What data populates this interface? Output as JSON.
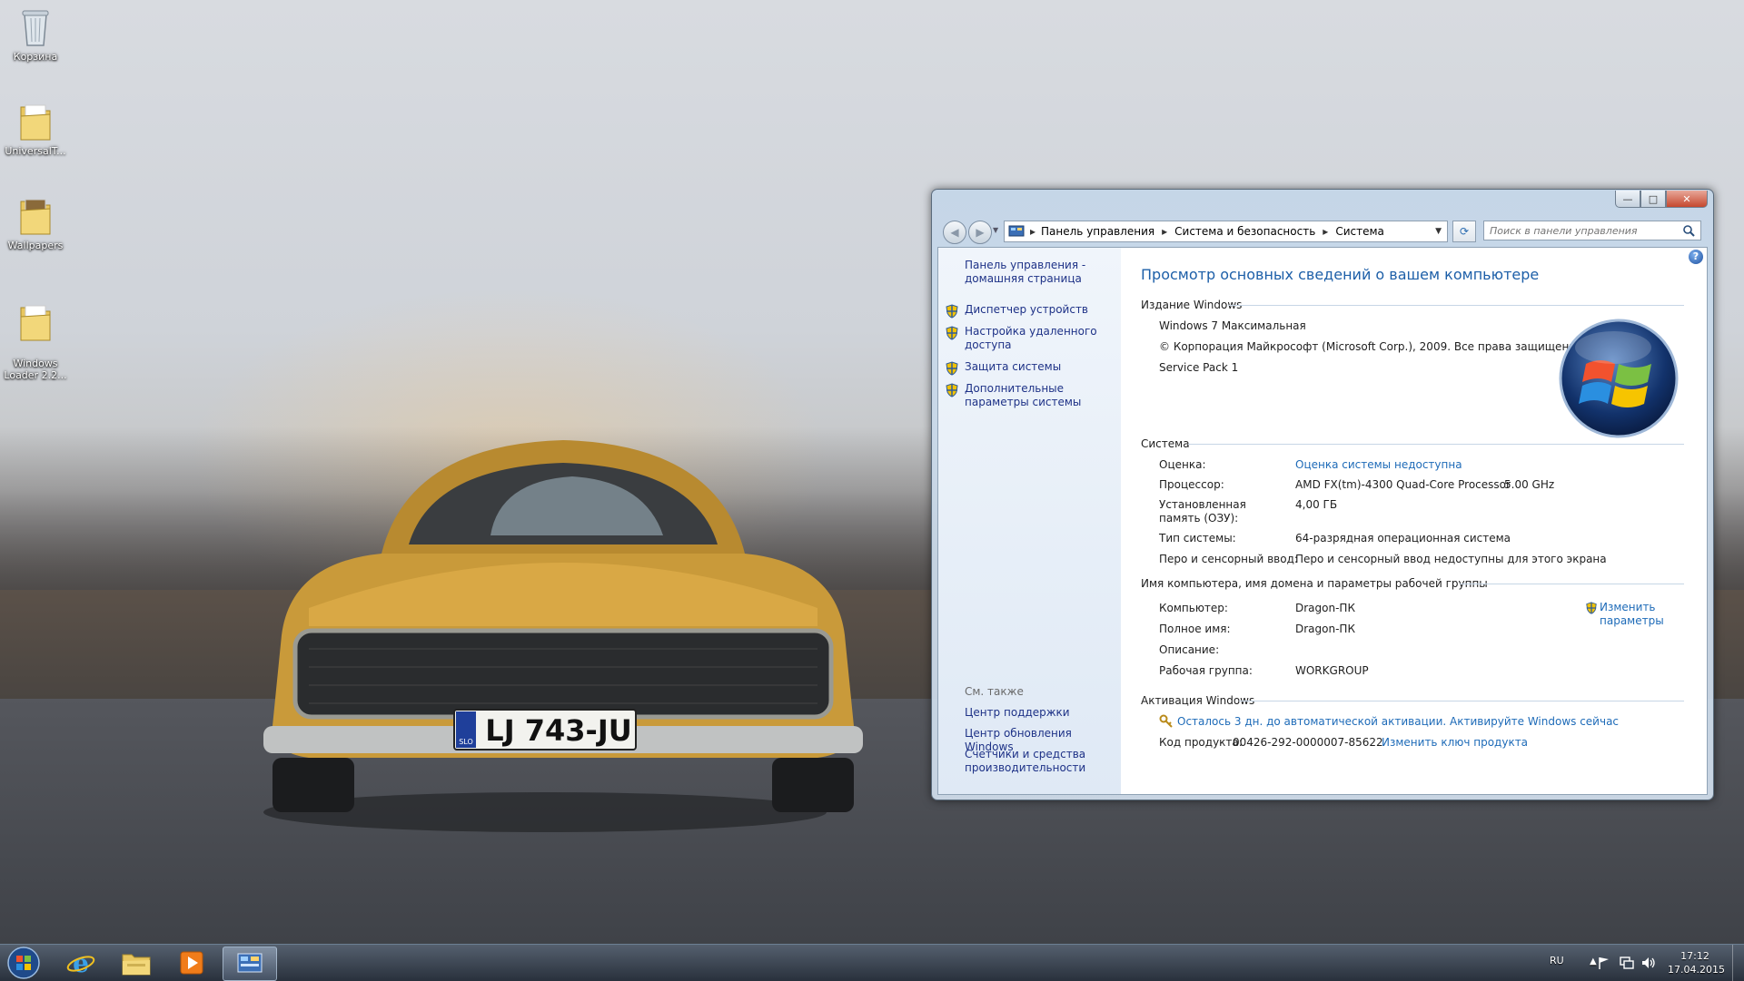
{
  "desktop": {
    "icons": [
      {
        "label": "Корзина",
        "icon": "recycle-bin-icon"
      },
      {
        "label": "UniversalT...",
        "icon": "folder-icon"
      },
      {
        "label": "Wallpapers",
        "icon": "folder-icon"
      },
      {
        "label": "Windows\nLoader 2.2...",
        "icon": "folder-icon"
      }
    ],
    "plate": "LJ 743-JU",
    "plate_country": "SLO"
  },
  "window": {
    "controls": {
      "minimize": "—",
      "maximize": "□",
      "close": "✕"
    },
    "breadcrumb": [
      "Панель управления",
      "Система и безопасность",
      "Система"
    ],
    "search_placeholder": "Поиск в панели управления",
    "left_pane": {
      "home_link": "Панель управления - домашняя страница",
      "tasks": [
        "Диспетчер устройств",
        "Настройка удаленного доступа",
        "Защита системы",
        "Дополнительные параметры системы"
      ],
      "see_also_heading": "См. также",
      "see_also": [
        "Центр поддержки",
        "Центр обновления Windows",
        "Счетчики и средства производительности"
      ]
    },
    "main": {
      "title": "Просмотр основных сведений о вашем компьютере",
      "edition": {
        "heading": "Издание Windows",
        "name": "Windows 7 Максимальная",
        "copyright": "© Корпорация Майкрософт (Microsoft Corp.), 2009. Все права защищены.",
        "service_pack": "Service Pack 1"
      },
      "system": {
        "heading": "Система",
        "rating_label": "Оценка:",
        "rating_value": "Оценка системы недоступна",
        "cpu_label": "Процессор:",
        "cpu_value": "AMD FX(tm)-4300 Quad-Core Processor",
        "cpu_speed": "5.00 GHz",
        "ram_label": "Установленная память (ОЗУ):",
        "ram_value": "4,00 ГБ",
        "type_label": "Тип системы:",
        "type_value": "64-разрядная операционная система",
        "pen_label": "Перо и сенсорный ввод:",
        "pen_value": "Перо и сенсорный ввод недоступны для этого экрана"
      },
      "computer": {
        "heading": "Имя компьютера, имя домена и параметры рабочей группы",
        "name_label": "Компьютер:",
        "name_value": "Dragon-ПК",
        "full_label": "Полное имя:",
        "full_value": "Dragon-ПК",
        "desc_label": "Описание:",
        "desc_value": "",
        "wg_label": "Рабочая группа:",
        "wg_value": "WORKGROUP",
        "change_link": "Изменить параметры"
      },
      "activation": {
        "heading": "Активация Windows",
        "notice": "Осталось 3 дн. до автоматической активации. Активируйте Windows сейчас",
        "key_label": "Код продукта:",
        "key_value": "00426-292-0000007-85622",
        "change_key": "Изменить ключ продукта"
      }
    }
  },
  "taskbar": {
    "language": "RU",
    "time": "17:12",
    "date": "17.04.2015",
    "apps": [
      "start-orb-icon",
      "internet-explorer-icon",
      "windows-explorer-icon",
      "media-player-icon",
      "control-panel-icon"
    ]
  },
  "colors": {
    "link": "#1e3287",
    "title": "#1d5fa8",
    "accent_link": "#1e6bb8"
  }
}
